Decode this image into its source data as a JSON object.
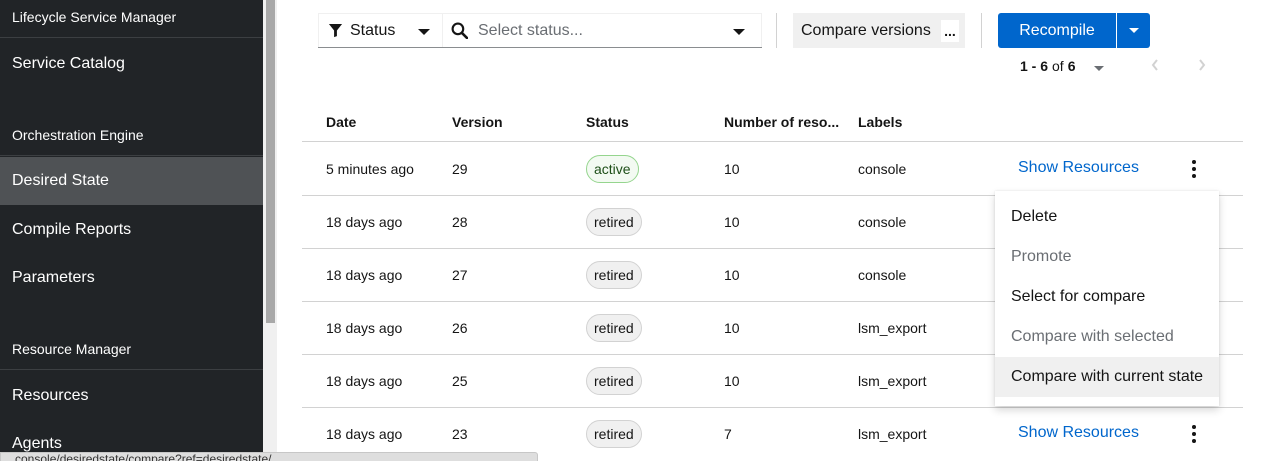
{
  "sidebar": {
    "groups": [
      {
        "title": "Lifecycle Service Manager",
        "items": [
          "Service Catalog"
        ]
      },
      {
        "title": "Orchestration Engine",
        "items": [
          "Desired State",
          "Compile Reports",
          "Parameters"
        ]
      },
      {
        "title": "Resource Manager",
        "items": [
          "Resources",
          "Agents"
        ]
      }
    ],
    "active_item": "Desired State"
  },
  "toolbar": {
    "filter_type": "Status",
    "filter_placeholder": "Select status...",
    "compare_label": "Compare versions",
    "compare_more": "...",
    "recompile_label": "Recompile"
  },
  "pagination": {
    "range": "1 - 6",
    "of_label": "of",
    "total": "6"
  },
  "table": {
    "headers": [
      "Date",
      "Version",
      "Status",
      "Number of reso...",
      "Labels"
    ],
    "rows": [
      {
        "date": "5 minutes ago",
        "version": "29",
        "status": "active",
        "resources": "10",
        "labels": "console",
        "action": "Show Resources"
      },
      {
        "date": "18 days ago",
        "version": "28",
        "status": "retired",
        "resources": "10",
        "labels": "console",
        "action": ""
      },
      {
        "date": "18 days ago",
        "version": "27",
        "status": "retired",
        "resources": "10",
        "labels": "console",
        "action": ""
      },
      {
        "date": "18 days ago",
        "version": "26",
        "status": "retired",
        "resources": "10",
        "labels": "lsm_export",
        "action": ""
      },
      {
        "date": "18 days ago",
        "version": "25",
        "status": "retired",
        "resources": "10",
        "labels": "lsm_export",
        "action": ""
      },
      {
        "date": "18 days ago",
        "version": "23",
        "status": "retired",
        "resources": "7",
        "labels": "lsm_export",
        "action": "Show Resources"
      }
    ]
  },
  "menu": {
    "items": [
      {
        "label": "Delete",
        "disabled": false
      },
      {
        "label": "Promote",
        "disabled": true
      },
      {
        "label": "Select for compare",
        "disabled": false
      },
      {
        "label": "Compare with selected",
        "disabled": true
      },
      {
        "label": "Compare with current state",
        "disabled": false
      }
    ]
  },
  "status_url": "...console/desiredstate/compare?ref=desiredstate/..."
}
